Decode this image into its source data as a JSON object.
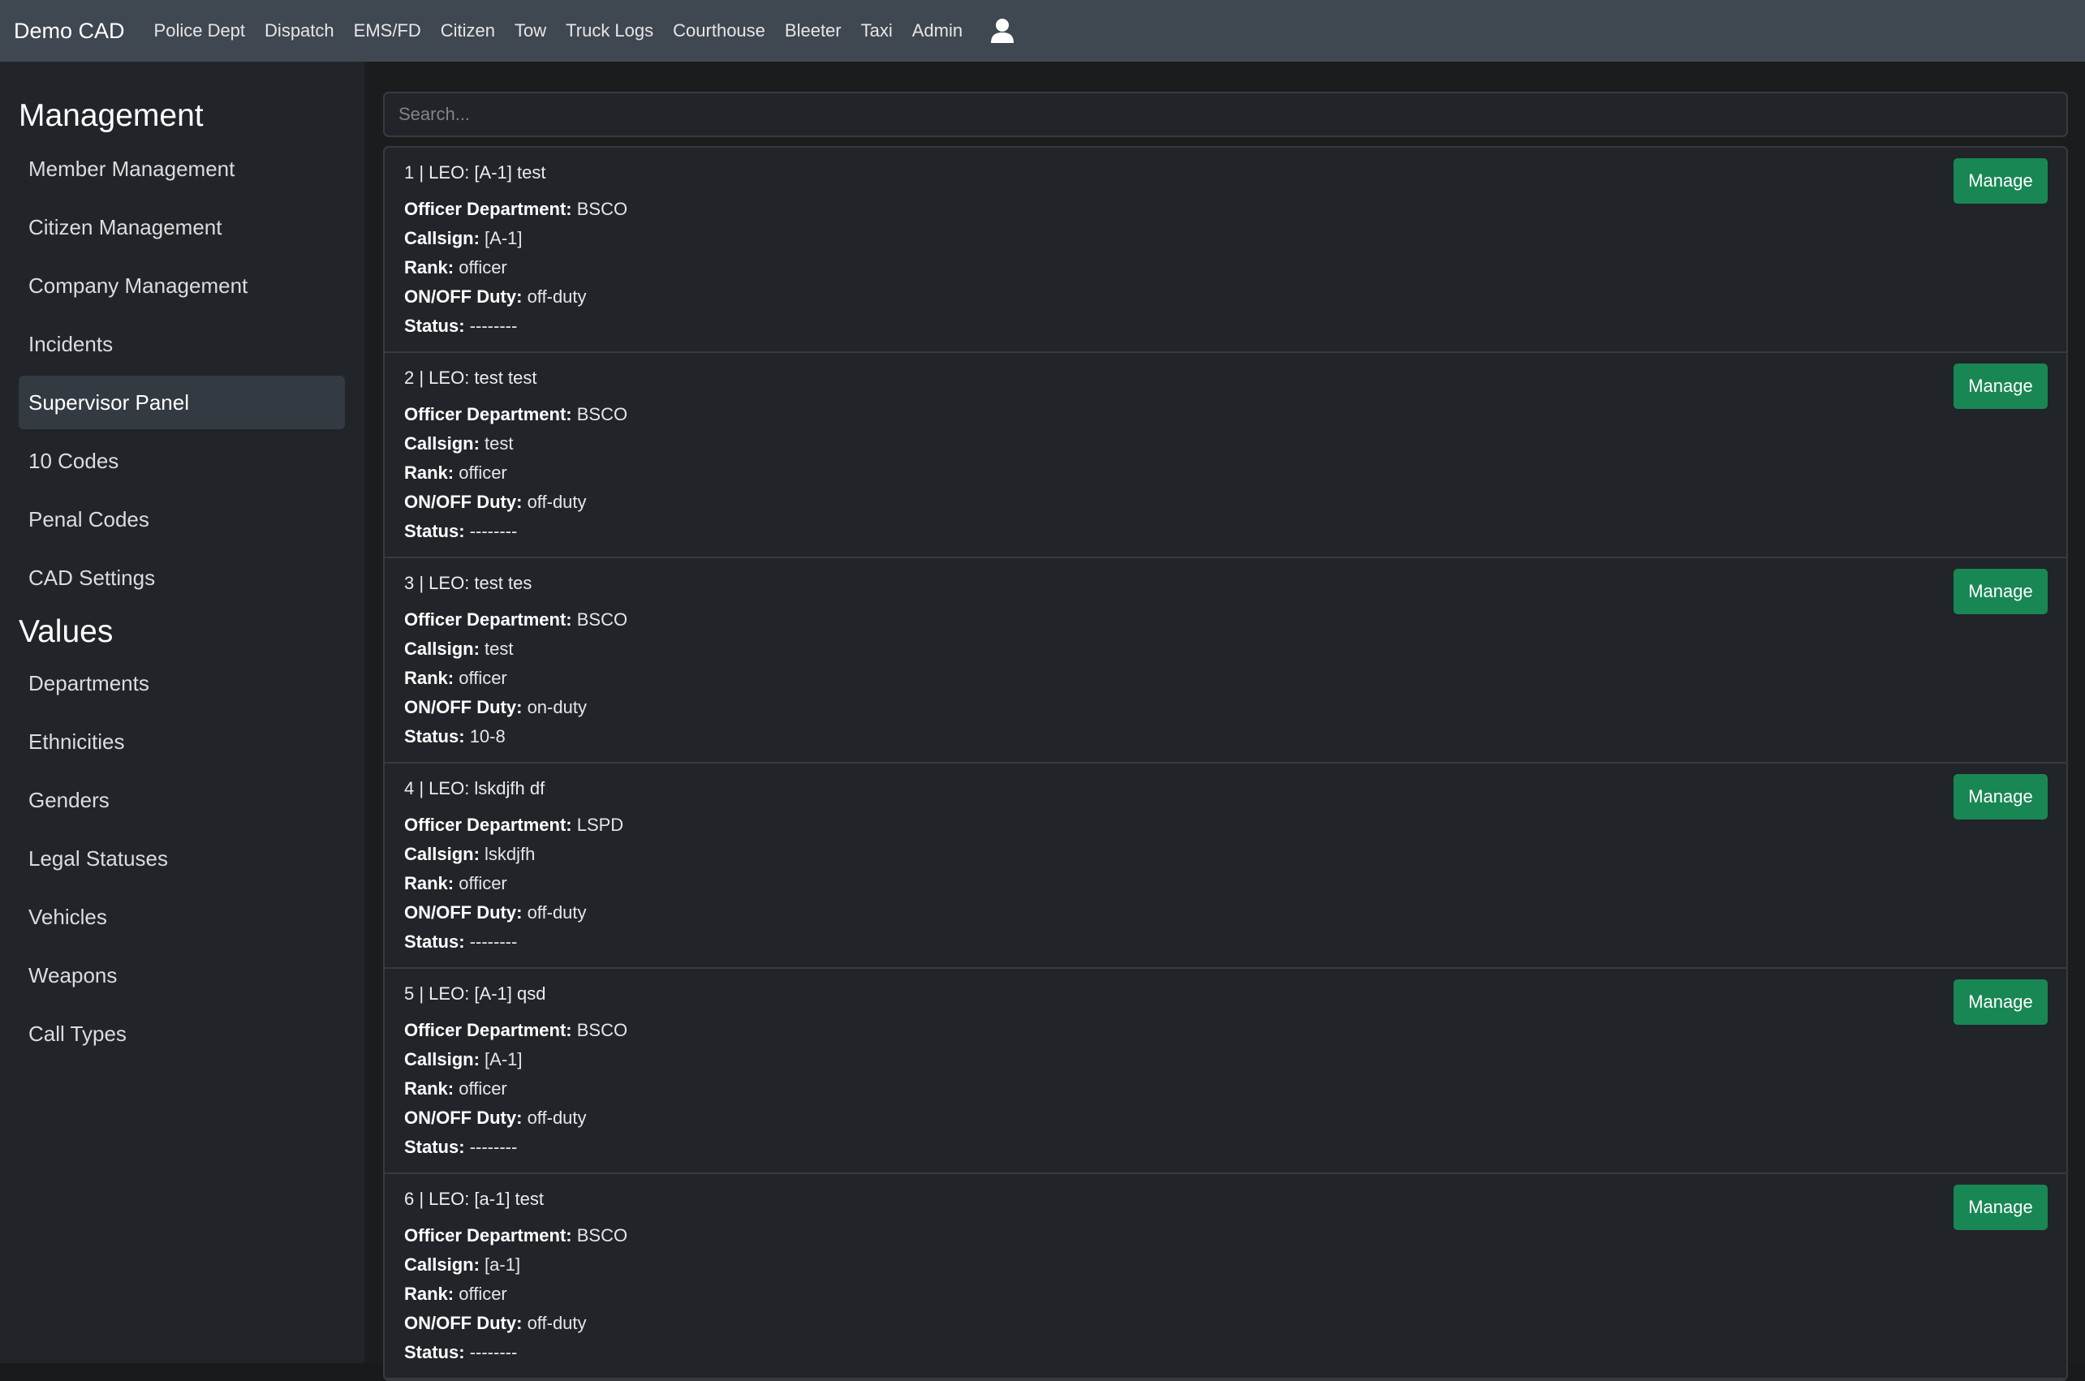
{
  "navbar": {
    "brand": "Demo CAD",
    "links": [
      "Police Dept",
      "Dispatch",
      "EMS/FD",
      "Citizen",
      "Tow",
      "Truck Logs",
      "Courthouse",
      "Bleeter",
      "Taxi",
      "Admin"
    ],
    "user_icon": "user-icon"
  },
  "sidebar": {
    "management_heading": "Management",
    "management_items": [
      {
        "label": "Member Management",
        "active": false
      },
      {
        "label": "Citizen Management",
        "active": false
      },
      {
        "label": "Company Management",
        "active": false
      },
      {
        "label": "Incidents",
        "active": false
      },
      {
        "label": "Supervisor Panel",
        "active": true
      },
      {
        "label": "10 Codes",
        "active": false
      },
      {
        "label": "Penal Codes",
        "active": false
      },
      {
        "label": "CAD Settings",
        "active": false
      }
    ],
    "values_heading": "Values",
    "values_items": [
      {
        "label": "Departments"
      },
      {
        "label": "Ethnicities"
      },
      {
        "label": "Genders"
      },
      {
        "label": "Legal Statuses"
      },
      {
        "label": "Vehicles"
      },
      {
        "label": "Weapons"
      },
      {
        "label": "Call Types"
      }
    ]
  },
  "search": {
    "placeholder": "Search...",
    "value": ""
  },
  "labels": {
    "department": "Officer Department:",
    "callsign": "Callsign:",
    "rank": "Rank:",
    "duty": "ON/OFF Duty:",
    "status": "Status:",
    "manage": "Manage"
  },
  "officers": [
    {
      "title": "1 | LEO: [A-1] test",
      "department": "BSCO",
      "callsign": "[A-1]",
      "rank": "officer",
      "duty": "off-duty",
      "status": "--------"
    },
    {
      "title": "2 | LEO: test test",
      "department": "BSCO",
      "callsign": "test",
      "rank": "officer",
      "duty": "off-duty",
      "status": "--------"
    },
    {
      "title": "3 | LEO: test tes",
      "department": "BSCO",
      "callsign": "test",
      "rank": "officer",
      "duty": "on-duty",
      "status": "10-8"
    },
    {
      "title": "4 | LEO: lskdjfh df",
      "department": "LSPD",
      "callsign": "lskdjfh",
      "rank": "officer",
      "duty": "off-duty",
      "status": "--------"
    },
    {
      "title": "5 | LEO: [A-1] qsd",
      "department": "BSCO",
      "callsign": "[A-1]",
      "rank": "officer",
      "duty": "off-duty",
      "status": "--------"
    },
    {
      "title": "6 | LEO: [a-1] test",
      "department": "BSCO",
      "callsign": "[a-1]",
      "rank": "officer",
      "duty": "off-duty",
      "status": "--------"
    }
  ],
  "colors": {
    "navbar_bg": "#3f4750",
    "sidebar_bg": "#212429",
    "active_item_bg": "#343a42",
    "manage_button": "#198754"
  }
}
